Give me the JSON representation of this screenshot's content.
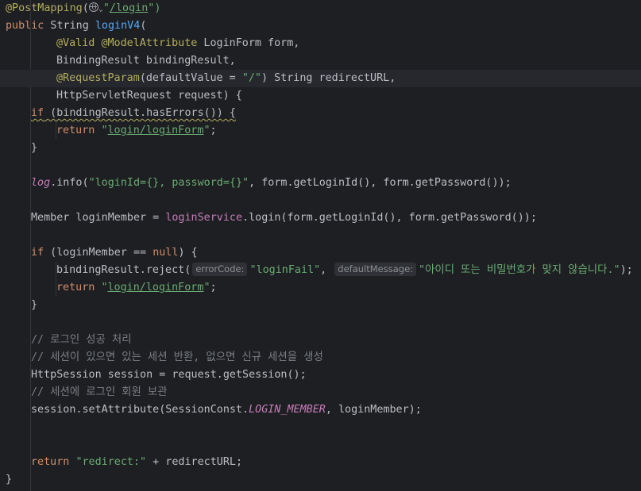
{
  "code": {
    "l1": {
      "a": "@PostMapping",
      "b": "(",
      "c": "\"",
      "d": "/login",
      "e": "\")"
    },
    "l2": {
      "a": "public",
      "b": " String ",
      "c": "loginV4",
      "d": "("
    },
    "l3": {
      "a": "@Valid",
      "b": " ",
      "c": "@ModelAttribute",
      "d": " LoginForm form,"
    },
    "l4": {
      "a": "BindingResult bindingResult,"
    },
    "l5": {
      "a": "@RequestParam",
      "b": "(defaultValue = ",
      "c": "\"/\"",
      "d": ") String redirectURL,"
    },
    "l6": {
      "a": "HttpServletRequest request) {"
    },
    "l7": {
      "a": "if",
      "b": " (bindingResult.hasErrors()) {"
    },
    "l8": {
      "a": "return",
      "b": " ",
      "c": "\"",
      "d": "login/loginForm",
      "e": "\"",
      "f": ";"
    },
    "l9": {
      "a": "}"
    },
    "l11": {
      "a": "log",
      "b": ".info(",
      "c": "\"loginId={}, password={}\"",
      "d": ", form.getLoginId(), form.getPassword());"
    },
    "l13": {
      "a": "Member loginMember = ",
      "b": "loginService",
      "c": ".login(form.getLoginId(), form.getPassword());"
    },
    "l15": {
      "a": "if",
      "b": " (loginMember == ",
      "c": "null",
      "d": ") {"
    },
    "l16": {
      "a": "bindingResult.reject(",
      "hint1": "errorCode:",
      "s1": "\"loginFail\"",
      "b": ", ",
      "hint2": "defaultMessage:",
      "s2": "\"아이디 또는 비밀번호가 맞지 않습니다.\"",
      "c": ");"
    },
    "l17": {
      "a": "return",
      "b": " ",
      "c": "\"",
      "d": "login/loginForm",
      "e": "\"",
      "f": ";"
    },
    "l18": {
      "a": "}"
    },
    "l20": {
      "a": "// 로그인 성공 처리"
    },
    "l21": {
      "a": "// 세션이 있으면 있는 세션 반환, 없으면 신규 세션을 생성"
    },
    "l22": {
      "a": "HttpSession session = request.getSession();"
    },
    "l23": {
      "a": "// 세션에 로그인 회원 보관"
    },
    "l24": {
      "a": "session.setAttribute(SessionConst.",
      "b": "LOGIN_MEMBER",
      "c": ", loginMember);"
    },
    "l27": {
      "a": "return",
      "b": " ",
      "c": "\"redirect:\"",
      "d": " + redirectURL;"
    },
    "l28": {
      "a": "}"
    }
  },
  "colors": {
    "background": "#1e1f22",
    "keyword": "#cf8e6d",
    "annotation": "#b3ae60",
    "string": "#6aab73",
    "comment": "#7a7e85",
    "method": "#56a8f5",
    "field": "#c77dbb",
    "text": "#bcbec4"
  },
  "icons": {
    "url_icon": "globe-icon",
    "dropdown": "chevron-down-icon"
  }
}
